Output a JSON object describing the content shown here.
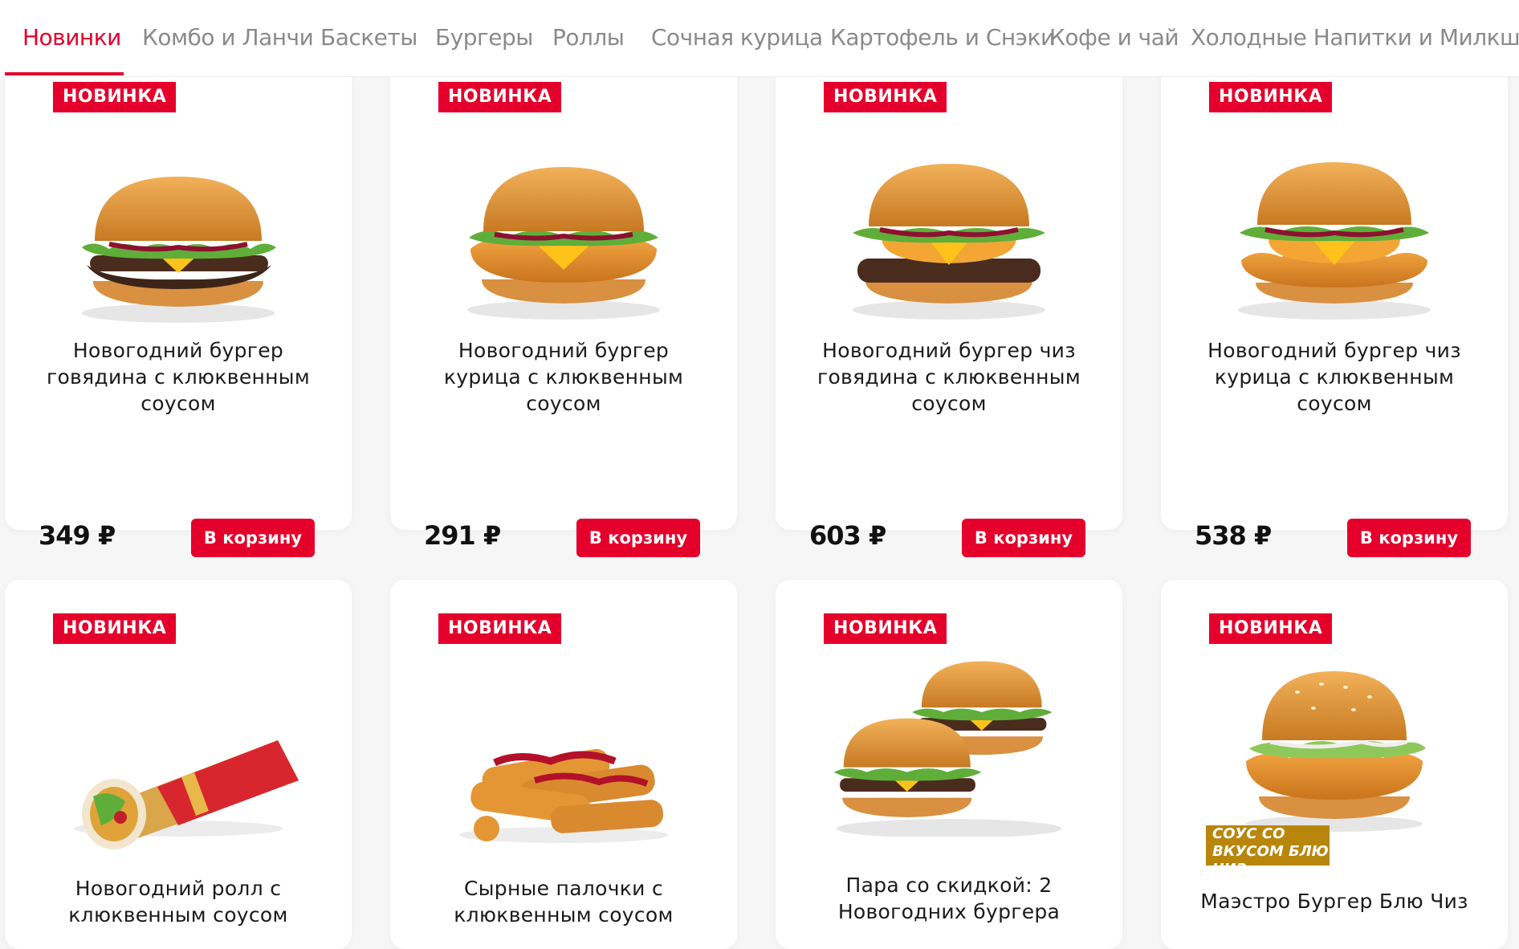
{
  "tabs": [
    {
      "label": "Новинки"
    },
    {
      "label": "Комбо и Ланчи"
    },
    {
      "label": "Баскеты"
    },
    {
      "label": "Бургеры"
    },
    {
      "label": "Роллы"
    },
    {
      "label": "Сочная курица"
    },
    {
      "label": "Картофель и Снэки"
    },
    {
      "label": "Кофе и чай"
    },
    {
      "label": "Холодные Напитки и Милкшейки"
    }
  ],
  "badge_label": "НОВИНКА",
  "cart_label": "В корзину",
  "products": [
    {
      "name": "Новогодний бургер говядина с клюквенным соусом",
      "price": "349 ₽",
      "image": "burger-beef"
    },
    {
      "name": "Новогодний бургер курица с клюквенным соусом",
      "price": "291 ₽",
      "image": "burger-chicken"
    },
    {
      "name": "Новогодний бургер чиз говядина с клюквенным соусом",
      "price": "603 ₽",
      "image": "burger-beef-cheese"
    },
    {
      "name": "Новогодний бургер чиз курица с клюквенным соусом",
      "price": "538 ₽",
      "image": "burger-chicken-cheese"
    },
    {
      "name": "Новогодний ролл с клюквенным соусом",
      "image": "roll"
    },
    {
      "name": "Сырные палочки с клюквенным соусом",
      "image": "cheese-sticks"
    },
    {
      "name": "Пара со скидкой: 2 Новогодних бургера",
      "image": "two-burgers"
    },
    {
      "name": "Маэстро Бургер Блю Чиз",
      "image": "maestro-burger",
      "promo_tag": "СОУС СО ВКУСОМ БЛЮ ЧИЗ"
    }
  ],
  "colors": {
    "accent": "#e4002b",
    "tab_inactive": "#8a8a8a",
    "background": "#f6f6f6"
  }
}
